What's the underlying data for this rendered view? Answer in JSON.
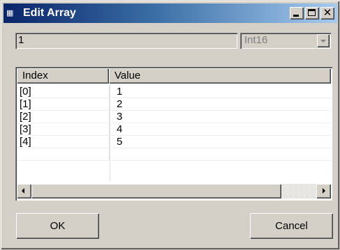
{
  "window": {
    "title": "Edit Array",
    "app_icon": "app-icon",
    "controls": [
      "minimize-icon",
      "maximize-icon",
      "close-icon"
    ]
  },
  "editor": {
    "value_field": "1",
    "type_select": {
      "selected": "Int16",
      "enabled": false
    }
  },
  "table": {
    "columns": [
      "Index",
      "Value"
    ],
    "rows": [
      {
        "index": "[0]",
        "value": "1"
      },
      {
        "index": "[1]",
        "value": "2"
      },
      {
        "index": "[2]",
        "value": "3"
      },
      {
        "index": "[3]",
        "value": "4"
      },
      {
        "index": "[4]",
        "value": "5"
      }
    ]
  },
  "buttons": {
    "ok": "OK",
    "cancel": "Cancel"
  },
  "colors": {
    "face": "#d4d0c8",
    "titlebar_start": "#0a246a",
    "titlebar_end": "#a6caf0",
    "disabled_text": "#808080"
  }
}
